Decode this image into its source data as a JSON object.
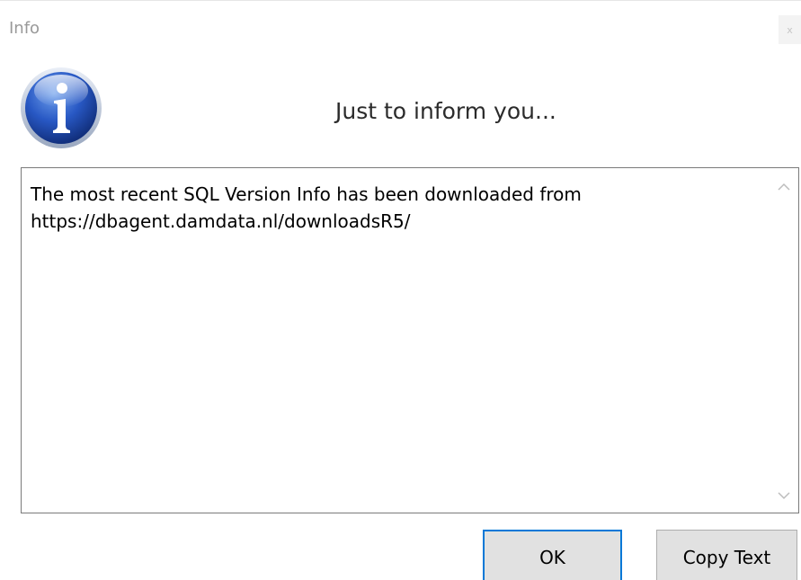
{
  "dialog": {
    "title": "Info",
    "close_label": "x",
    "heading": "Just to inform you...",
    "message": "The most recent SQL Version Info has been downloaded from\nhttps://dbagent.damdata.nl/downloadsR5/"
  },
  "buttons": {
    "ok_label": "OK",
    "copy_label": "Copy Text"
  },
  "colors": {
    "focus_border": "#0078d7",
    "icon_blue": "#1f4fb5"
  },
  "icons": {
    "dialog_icon": "info-icon",
    "scroll_up": "chevron-up-icon",
    "scroll_down": "chevron-down-icon"
  }
}
